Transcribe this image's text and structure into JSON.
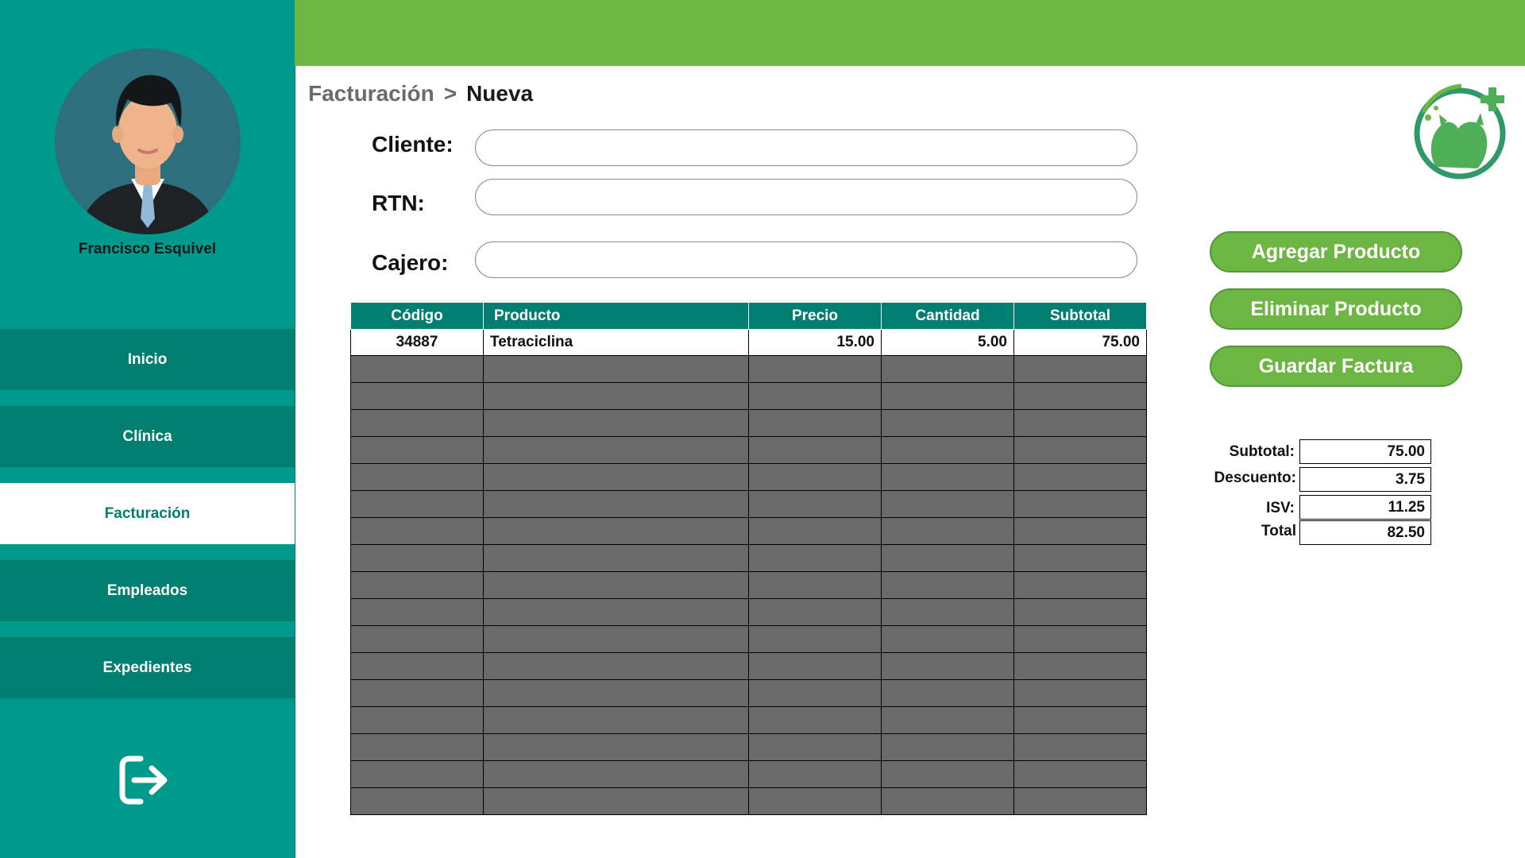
{
  "app": {
    "accent": "#6db644",
    "primary": "#007f70",
    "sidebar_bg": "#009a8c"
  },
  "user": {
    "name": "Francisco Esquivel",
    "avatar_icon": "user-avatar"
  },
  "sidebar": {
    "items": [
      {
        "label": "Inicio",
        "active": false
      },
      {
        "label": "Clínica",
        "active": false
      },
      {
        "label": "Facturación",
        "active": true
      },
      {
        "label": "Empleados",
        "active": false
      },
      {
        "label": "Expedientes",
        "active": false
      }
    ],
    "logout_icon": "logout-icon"
  },
  "breadcrumb": {
    "parent": "Facturación",
    "separator": ">",
    "current": "Nueva"
  },
  "logo_icon": "veterinary-pets-logo",
  "form": {
    "cliente": {
      "label": "Cliente:",
      "value": "",
      "placeholder": ""
    },
    "rtn": {
      "label": "RTN:",
      "value": "",
      "placeholder": ""
    },
    "cajero": {
      "label": "Cajero:",
      "value": "",
      "placeholder": ""
    }
  },
  "table": {
    "columns": [
      "Código",
      "Producto",
      "Precio",
      "Cantidad",
      "Subtotal"
    ],
    "rows": [
      {
        "codigo": "34887",
        "producto": "Tetraciclina",
        "precio": "15.00",
        "cantidad": "5.00",
        "subtotal": "75.00"
      }
    ]
  },
  "actions": {
    "add": "Agregar Producto",
    "remove": "Eliminar Producto",
    "save": "Guardar Factura"
  },
  "totals": {
    "subtotal_label": "Subtotal:",
    "subtotal": "75.00",
    "descuento_label": "Descuento:",
    "descuento": "3.75",
    "isv_label": "ISV:",
    "isv": "11.25",
    "total_label": "Total",
    "total": "82.50"
  }
}
